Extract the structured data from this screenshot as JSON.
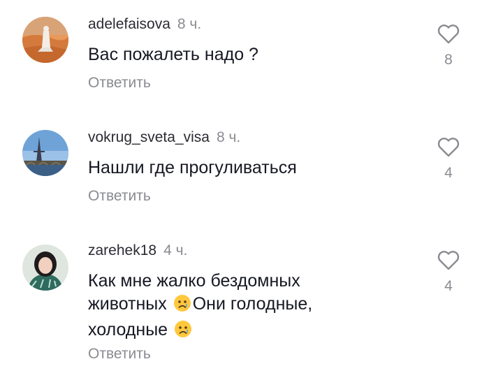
{
  "comments": [
    {
      "username": "adelefaisova",
      "time": "8 ч.",
      "text": "Вас пожалеть надо ?",
      "reply_label": "Ответить",
      "likes": "8",
      "avatar_icon": "avatar-desert-photo"
    },
    {
      "username": "vokrug_sveta_visa",
      "time": "8 ч.",
      "text": "Нашли где прогуливаться",
      "reply_label": "Ответить",
      "likes": "4",
      "avatar_icon": "avatar-eiffel-tower-photo"
    },
    {
      "username": "zarehek18",
      "time": "4 ч.",
      "text_parts": [
        "Как мне жалко бездомных животных ",
        "Они голодные, холодные "
      ],
      "reply_label": "Ответить",
      "likes": "4",
      "avatar_icon": "avatar-woman-photo",
      "emoji": "sad-face-emoji"
    }
  ],
  "colors": {
    "username": "#2b2b33",
    "secondary": "#8a8b91",
    "text": "#161823",
    "emoji": "#ffc83d"
  },
  "icons": {
    "like": "heart-outline-icon"
  }
}
